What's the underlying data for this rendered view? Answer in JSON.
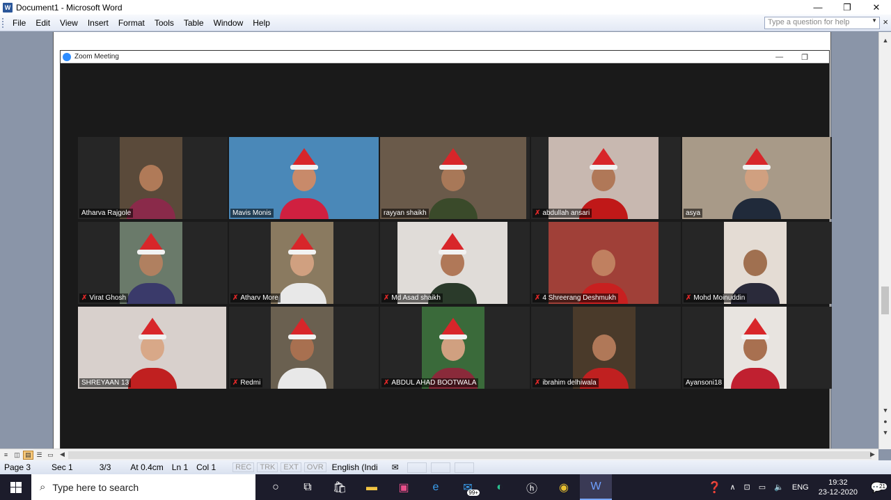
{
  "window": {
    "title": "Document1 - Microsoft Word",
    "minimize": "—",
    "restore": "❐",
    "close": "✕"
  },
  "menu": {
    "items": [
      "File",
      "Edit",
      "View",
      "Insert",
      "Format",
      "Tools",
      "Table",
      "Window",
      "Help"
    ],
    "help_placeholder": "Type a question for help",
    "close": "×"
  },
  "zoom": {
    "title": "Zoom Meeting",
    "minimize": "—",
    "restore": "❐",
    "participants": [
      {
        "name": "Atharva Rajgole",
        "muted": false
      },
      {
        "name": "Mavis Monis",
        "muted": false
      },
      {
        "name": "rayyan shaikh",
        "muted": false
      },
      {
        "name": "abdullah ansari",
        "muted": true
      },
      {
        "name": "asya",
        "muted": false
      },
      {
        "name": "Virat Ghosh",
        "muted": true
      },
      {
        "name": "Atharv More",
        "muted": true
      },
      {
        "name": "Md Asad shaikh",
        "muted": true
      },
      {
        "name": "4 Shreerang Deshmukh",
        "muted": true
      },
      {
        "name": "Mohd Moinuddin",
        "muted": true
      },
      {
        "name": "SHREYAAN 13",
        "muted": false
      },
      {
        "name": "Redmi",
        "muted": true
      },
      {
        "name": "ABDUL AHAD BOOTWALA",
        "muted": true
      },
      {
        "name": "ibrahim delhiwala",
        "muted": true
      },
      {
        "name": "Ayansoni18",
        "muted": false
      }
    ]
  },
  "status": {
    "page": "Page 3",
    "sec": "Sec 1",
    "pages": "3/3",
    "at": "At 0.4cm",
    "ln": "Ln 1",
    "col": "Col 1",
    "rec": "REC",
    "trk": "TRK",
    "ext": "EXT",
    "ovr": "OVR",
    "lang": "English (Indi"
  },
  "taskbar": {
    "search_placeholder": "Type here to search",
    "mail_badge": "99+",
    "lang": "ENG",
    "time": "19:32",
    "date": "23-12-2020",
    "notif_count": "21"
  }
}
